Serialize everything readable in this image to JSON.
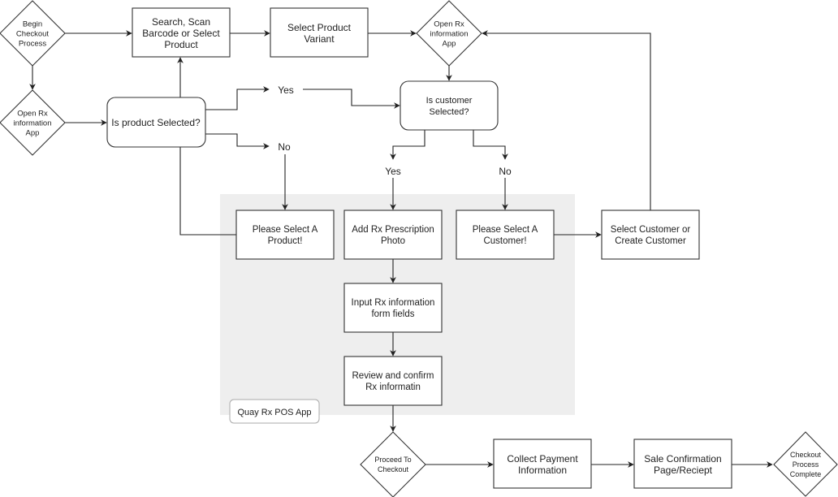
{
  "diagram": {
    "group": {
      "label": "Quay Rx POS App"
    },
    "nodes": {
      "begin": {
        "shape": "diamond",
        "lines": [
          "Begin",
          "Checkout",
          "Process"
        ]
      },
      "open_rx_left": {
        "shape": "diamond",
        "lines": [
          "Open Rx",
          "information",
          "App"
        ]
      },
      "search": {
        "shape": "rect",
        "lines": [
          "Search, Scan",
          "Barcode or Select",
          "Product"
        ]
      },
      "variant": {
        "shape": "rect",
        "lines": [
          "Select Product",
          "Variant"
        ]
      },
      "open_rx_top": {
        "shape": "diamond",
        "lines": [
          "Open Rx",
          "information",
          "App"
        ]
      },
      "product_selected": {
        "shape": "rounded",
        "lines": [
          "Is product Selected?"
        ]
      },
      "customer_selected": {
        "shape": "rounded",
        "lines": [
          "Is customer",
          "Selected?"
        ]
      },
      "select_product_msg": {
        "shape": "rect",
        "lines": [
          "Please Select A",
          "Product!"
        ]
      },
      "add_photo": {
        "shape": "rect",
        "lines": [
          "Add Rx Prescription",
          "Photo"
        ]
      },
      "select_customer_msg": {
        "shape": "rect",
        "lines": [
          "Please Select A",
          "Customer!"
        ]
      },
      "select_create_customer": {
        "shape": "rect",
        "lines": [
          "Select Customer or",
          "Create Customer"
        ]
      },
      "input_rx": {
        "shape": "rect",
        "lines": [
          "Input Rx information",
          "form fields"
        ]
      },
      "review_rx": {
        "shape": "rect",
        "lines": [
          "Review and confirm",
          "Rx informatin"
        ]
      },
      "proceed": {
        "shape": "diamond",
        "lines": [
          "Proceed To",
          "Checkout"
        ]
      },
      "payment": {
        "shape": "rect",
        "lines": [
          "Collect Payment",
          "Information"
        ]
      },
      "confirmation": {
        "shape": "rect",
        "lines": [
          "Sale Confirmation",
          "Page/Reciept"
        ]
      },
      "complete": {
        "shape": "diamond",
        "lines": [
          "Checkout",
          "Process",
          "Complete"
        ]
      }
    },
    "edge_labels": {
      "product_yes": "Yes",
      "product_no": "No",
      "customer_yes": "Yes",
      "customer_no": "No"
    },
    "edges": [
      {
        "from": "begin",
        "to": "search"
      },
      {
        "from": "begin",
        "to": "open_rx_left"
      },
      {
        "from": "open_rx_left",
        "to": "product_selected"
      },
      {
        "from": "product_selected",
        "to": "search"
      },
      {
        "from": "search",
        "to": "variant"
      },
      {
        "from": "variant",
        "to": "open_rx_top"
      },
      {
        "from": "open_rx_top",
        "to": "customer_selected"
      },
      {
        "from": "product_selected",
        "to": "customer_selected",
        "label": "Yes"
      },
      {
        "from": "product_selected",
        "to": "select_product_msg",
        "label": "No"
      },
      {
        "from": "select_product_msg",
        "to": "product_selected"
      },
      {
        "from": "customer_selected",
        "to": "add_photo",
        "label": "Yes"
      },
      {
        "from": "customer_selected",
        "to": "select_customer_msg",
        "label": "No"
      },
      {
        "from": "select_customer_msg",
        "to": "select_create_customer"
      },
      {
        "from": "select_create_customer",
        "to": "open_rx_top"
      },
      {
        "from": "add_photo",
        "to": "input_rx"
      },
      {
        "from": "input_rx",
        "to": "review_rx"
      },
      {
        "from": "review_rx",
        "to": "proceed"
      },
      {
        "from": "proceed",
        "to": "payment"
      },
      {
        "from": "payment",
        "to": "confirmation"
      },
      {
        "from": "confirmation",
        "to": "complete"
      }
    ]
  }
}
